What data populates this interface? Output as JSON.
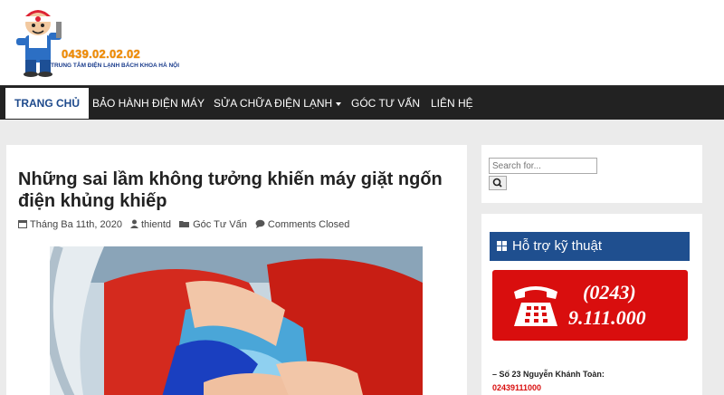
{
  "header": {
    "logo_phone": "0439.02.02.02",
    "logo_subtitle": "TRUNG TÂM ĐIỆN LẠNH BÁCH KHOA HÀ NỘI"
  },
  "nav": {
    "items": [
      {
        "label": "TRANG CHỦ",
        "active": true
      },
      {
        "label": "BẢO HÀNH ĐIỆN MÁY"
      },
      {
        "label": "SỬA CHỮA ĐIỆN LẠNH",
        "has_dropdown": true
      },
      {
        "label": "GÓC TƯ VẤN"
      },
      {
        "label": "LIÊN HỆ"
      }
    ]
  },
  "post": {
    "title": "Những sai lầm không tưởng khiến máy giặt ngốn điện khủng khiếp",
    "date": "Tháng Ba 11th, 2020",
    "author": "thientd",
    "category": "Góc Tư Vấn",
    "comments": "Comments Closed"
  },
  "sidebar": {
    "search": {
      "placeholder": "Search for..."
    },
    "support": {
      "title": "Hỗ trợ kỹ thuật",
      "hotline_area": "(0243)",
      "hotline_number": "9.111.000",
      "address": "– Số 23 Nguyễn Khánh Toàn:",
      "address_phone": "02439111000"
    }
  },
  "colors": {
    "nav_bg": "#222222",
    "accent_blue": "#1f4f8f",
    "hotline_red": "#d90e0e",
    "logo_orange": "#f08c00"
  }
}
